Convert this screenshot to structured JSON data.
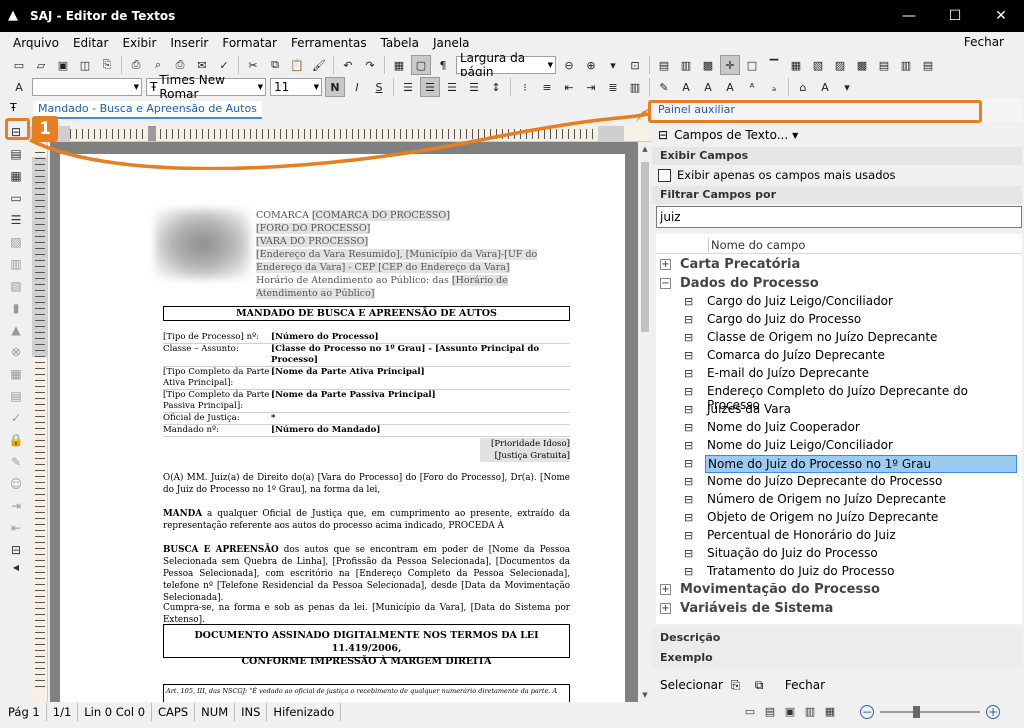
{
  "window": {
    "title": "SAJ - Editor de Textos",
    "controls": {
      "minimize": "—",
      "maximize": "☐",
      "close": "✕"
    }
  },
  "menu": {
    "items": [
      "Arquivo",
      "Editar",
      "Exibir",
      "Inserir",
      "Formatar",
      "Ferramentas",
      "Tabela",
      "Janela"
    ],
    "fechar": "Fechar"
  },
  "toolbar": {
    "zoom_mode": "Largura da págin",
    "font_name": "Times New Romar",
    "font_size": "11",
    "font_icon": "Ŧ",
    "bold": "N",
    "italic": "I",
    "underline": "S"
  },
  "document_tab": "Mandado - Busca e Apreensão de Autos",
  "document": {
    "header": {
      "line1_label": "COMARCA",
      "line1_field": "[COMARCA DO PROCESSO]",
      "line2_field": "[FORO DO PROCESSO]",
      "line3_field": "[VARA DO PROCESSO]",
      "line4_field": "[Endereço da Vara Resumido], [Município da Vara]-[UF do Endereço da Vara] - CEP [CEP do Endereço da Vara]",
      "line5_label": "Horário de Atendimento ao Público: das",
      "line5_field": "[Horário de Atendimento ao Público]"
    },
    "title": "MANDADO DE BUSCA E APREENSÃO DE AUTOS",
    "fields": [
      {
        "k": "[Tipo de Processo] nº:",
        "v": "[Número do Processo]"
      },
      {
        "k": "Classe – Assunto:",
        "v": "[Classe do Processo no 1º Grau] - [Assunto Principal do Processo]"
      },
      {
        "k": "[Tipo Completo da Parte Ativa Principal]:",
        "v": "[Nome da Parte Ativa Principal]"
      },
      {
        "k": "[Tipo Completo da Parte Passiva Principal]:",
        "v": "[Nome da Parte Passiva Principal]"
      },
      {
        "k": "Oficial de Justiça:",
        "v": "*"
      },
      {
        "k": "Mandado nº:",
        "v": "[Número do Mandado]"
      }
    ],
    "priority": [
      "[Prioridade Idoso]",
      "[Justiça Gratuita]"
    ],
    "para1": "O(A) MM. Juiz(a) de Direito do(a) [Vara do Processo] do [Foro do Processo], Dr(a). [Nome do Juiz do Processo no 1º Grau], na forma da lei,",
    "para2_bold": "MANDA",
    "para2": " a qualquer Oficial de Justiça que, em cumprimento ao presente, extraído da representação referente aos autos do processo acima indicado, PROCEDA À",
    "para3_bold": "BUSCA E APREENSÃO",
    "para3": " dos autos que se encontram em poder de [Nome da Pessoa Selecionada sem Quebra de Linha], [Profissão da Pessoa Selecionada], [Documentos da Pessoa Selecionada], com escritório na [Endereço Completo da Pessoa Selecionada], telefone nº [Telefone Residencial da Pessoa Selecionada], desde  [Data da Movimentação Selecionada].",
    "para4": "Cumpra-se, na forma e sob as penas da lei. [Município da Vara], [Data do Sistema por Extenso].",
    "sign_line1": "DOCUMENTO ASSINADO DIGITALMENTE NOS TERMOS DA LEI 11.419/2006,",
    "sign_line2": "CONFORME IMPRESSÃO À MARGEM DIREITA",
    "footnote": "Art. 105, III, das NSCGJ: \"É vedado ao oficial de justiça o recebimento de qualquer numerário diretamente da parte. A"
  },
  "panel": {
    "title": "Painel auxiliar",
    "campos_button": "Campos de Texto...",
    "exibir_campos": "Exibir Campos",
    "checkbox_label": "Exibir apenas os campos mais usados",
    "filtrar_label": "Filtrar Campos por",
    "filter_value": "juiz",
    "column_header": "Nome do campo",
    "groups": [
      {
        "label": "Carta Precatória",
        "exp": "+"
      },
      {
        "label": "Dados do Processo",
        "exp": "−"
      },
      {
        "label": "Movimentação do Processo",
        "exp": "+"
      },
      {
        "label": "Variáveis de Sistema",
        "exp": "+"
      }
    ],
    "items": [
      "Cargo do Juiz Leigo/Conciliador",
      "Cargo do Juiz do Processo",
      "Classe de Origem no Juízo Deprecante",
      "Comarca do Juízo Deprecante",
      "E-mail do Juízo Deprecante",
      "Endereço Completo do Juízo Deprecante do Processo",
      "Juízes da Vara",
      "Nome do Juiz Cooperador",
      "Nome do Juiz Leigo/Conciliador",
      "Nome do Juiz do Processo no 1º Grau",
      "Nome do Juízo Deprecante do Processo",
      "Número de Origem no Juízo Deprecante",
      "Objeto de Origem no Juízo Deprecante",
      "Percentual de Honorário do Juiz",
      "Situação do Juiz do Processo",
      "Tratamento do Juiz do Processo"
    ],
    "selected_item": "Nome do Juiz do Processo no 1º Grau",
    "descricao": "Descrição",
    "exemplo": "Exemplo",
    "selecionar": "Selecionar",
    "fechar": "Fechar"
  },
  "status": {
    "page": "Pág 1",
    "pages": "1/1",
    "position": "Lin 0  Col 0",
    "caps": "CAPS",
    "num": "NUM",
    "ins": "INS",
    "hyphen": "Hifenizado"
  },
  "annotation": {
    "badge": "1",
    "color": "#e67e22"
  },
  "colors": {
    "accent": "#1a5fb4",
    "selection": "#9ccbf2",
    "highlight": "#e67e22"
  }
}
